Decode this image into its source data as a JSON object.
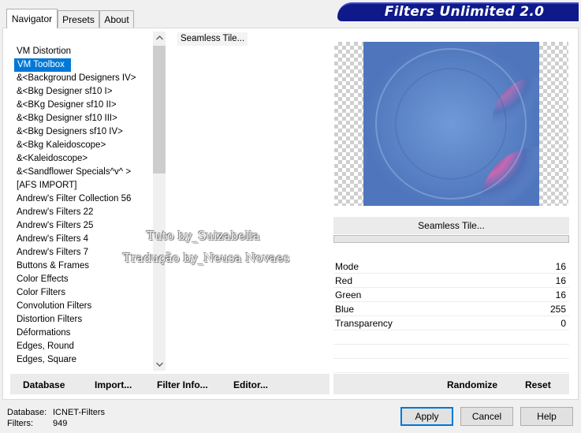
{
  "banner": {
    "title": "Filters Unlimited 2.0"
  },
  "tabs": [
    {
      "label": "Navigator",
      "active": true
    },
    {
      "label": "Presets",
      "active": false
    },
    {
      "label": "About",
      "active": false
    }
  ],
  "categories": [
    "VM Distortion",
    "VM Toolbox",
    "&<Background Designers IV>",
    "&<Bkg Designer sf10 I>",
    "&<BKg Designer sf10 II>",
    "&<Bkg Designer sf10 III>",
    "&<Bkg Designers sf10 IV>",
    "&<Bkg Kaleidoscope>",
    "&<Kaleidoscope>",
    "&<Sandflower Specials^v^ >",
    "[AFS IMPORT]",
    "Andrew's Filter Collection 56",
    "Andrew's Filters 22",
    "Andrew's Filters 25",
    "Andrew's Filters 4",
    "Andrew's Filters 7",
    "Buttons & Frames",
    "Color Effects",
    "Color Filters",
    "Convolution Filters",
    "Distortion Filters",
    "Déformations",
    "Edges, Round",
    "Edges, Square"
  ],
  "selected_category": "VM Toolbox",
  "filters": [
    "Seamless Tile..."
  ],
  "selected_filter_name": "Seamless Tile...",
  "params": [
    {
      "label": "Mode",
      "value": "16"
    },
    {
      "label": "Red",
      "value": "16"
    },
    {
      "label": "Green",
      "value": "16"
    },
    {
      "label": "Blue",
      "value": "255"
    },
    {
      "label": "Transparency",
      "value": "0"
    }
  ],
  "left_buttons": {
    "database": "Database",
    "import": "Import...",
    "filter_info": "Filter Info...",
    "editor": "Editor..."
  },
  "right_buttons": {
    "randomize": "Randomize",
    "reset": "Reset"
  },
  "status": {
    "database_label": "Database:",
    "database_value": "ICNET-Filters",
    "filters_label": "Filters:",
    "filters_value": "949"
  },
  "dialog_buttons": {
    "apply": "Apply",
    "cancel": "Cancel",
    "help": "Help"
  },
  "watermark": {
    "line1": "Tuto by_Suizabella",
    "line2": "Tradução by_Neusa Novaes"
  },
  "colors": {
    "banner": "#0e1a8a",
    "selection": "#0078d7",
    "preview_base": "#5a86c6"
  },
  "icons": {
    "scroll_up": "chevron-up-icon",
    "scroll_down": "chevron-down-icon"
  }
}
